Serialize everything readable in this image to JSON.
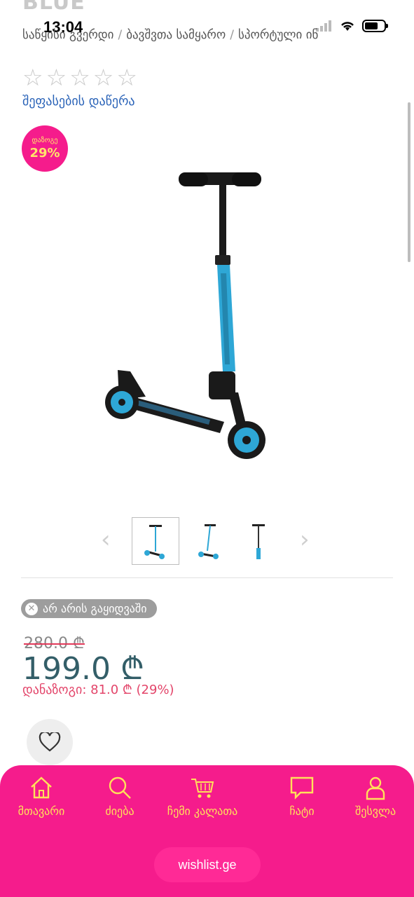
{
  "status_bar": {
    "time": "13:04"
  },
  "product": {
    "title_peek": "BLUE",
    "breadcrumb": [
      "საწყისი გვერდი",
      "ბავშვთა სამყარო",
      "სპორტული ინ"
    ],
    "rating": {
      "stars_filled": 0,
      "stars_total": 5
    },
    "write_review": "შეფასების დაწერა",
    "discount_badge": {
      "label": "დაზოგე",
      "percent": "29%"
    },
    "stock_status": "არ არის გაყიდვაში",
    "old_price": "280.0 ₾",
    "price": "199.0 ₾",
    "savings": "დანაზოგი: 81.0 ₾ (29%)",
    "thumbnails": [
      "scooter-front-icon",
      "scooter-side-icon",
      "scooter-back-icon"
    ]
  },
  "bottom_nav": {
    "items": [
      {
        "label": "მთავარი",
        "icon": "home-icon"
      },
      {
        "label": "ძიება",
        "icon": "search-icon"
      },
      {
        "label": "ჩემი კალათა",
        "icon": "cart-icon"
      },
      {
        "label": "ჩატი",
        "icon": "chat-icon"
      },
      {
        "label": "შესვლა",
        "icon": "user-icon"
      }
    ],
    "site": "wishlist.ge"
  },
  "colors": {
    "brand_pink": "#f51c8c",
    "nav_text": "#ffe15a",
    "price": "#335e68",
    "savings": "#e3456a",
    "scooter_accent": "#2ea7d6"
  }
}
